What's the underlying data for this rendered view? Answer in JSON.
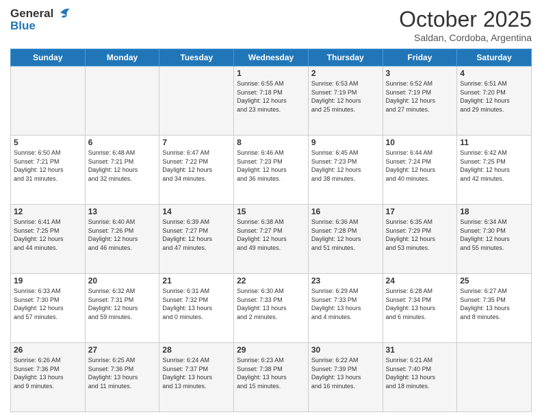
{
  "header": {
    "logo": {
      "line1": "General",
      "line2": "Blue"
    },
    "title": "October 2025",
    "subtitle": "Saldan, Cordoba, Argentina"
  },
  "weekdays": [
    "Sunday",
    "Monday",
    "Tuesday",
    "Wednesday",
    "Thursday",
    "Friday",
    "Saturday"
  ],
  "rows": [
    [
      {
        "day": "",
        "info": ""
      },
      {
        "day": "",
        "info": ""
      },
      {
        "day": "",
        "info": ""
      },
      {
        "day": "1",
        "info": "Sunrise: 6:55 AM\nSunset: 7:18 PM\nDaylight: 12 hours\nand 23 minutes."
      },
      {
        "day": "2",
        "info": "Sunrise: 6:53 AM\nSunset: 7:19 PM\nDaylight: 12 hours\nand 25 minutes."
      },
      {
        "day": "3",
        "info": "Sunrise: 6:52 AM\nSunset: 7:19 PM\nDaylight: 12 hours\nand 27 minutes."
      },
      {
        "day": "4",
        "info": "Sunrise: 6:51 AM\nSunset: 7:20 PM\nDaylight: 12 hours\nand 29 minutes."
      }
    ],
    [
      {
        "day": "5",
        "info": "Sunrise: 6:50 AM\nSunset: 7:21 PM\nDaylight: 12 hours\nand 31 minutes."
      },
      {
        "day": "6",
        "info": "Sunrise: 6:48 AM\nSunset: 7:21 PM\nDaylight: 12 hours\nand 32 minutes."
      },
      {
        "day": "7",
        "info": "Sunrise: 6:47 AM\nSunset: 7:22 PM\nDaylight: 12 hours\nand 34 minutes."
      },
      {
        "day": "8",
        "info": "Sunrise: 6:46 AM\nSunset: 7:23 PM\nDaylight: 12 hours\nand 36 minutes."
      },
      {
        "day": "9",
        "info": "Sunrise: 6:45 AM\nSunset: 7:23 PM\nDaylight: 12 hours\nand 38 minutes."
      },
      {
        "day": "10",
        "info": "Sunrise: 6:44 AM\nSunset: 7:24 PM\nDaylight: 12 hours\nand 40 minutes."
      },
      {
        "day": "11",
        "info": "Sunrise: 6:42 AM\nSunset: 7:25 PM\nDaylight: 12 hours\nand 42 minutes."
      }
    ],
    [
      {
        "day": "12",
        "info": "Sunrise: 6:41 AM\nSunset: 7:25 PM\nDaylight: 12 hours\nand 44 minutes."
      },
      {
        "day": "13",
        "info": "Sunrise: 6:40 AM\nSunset: 7:26 PM\nDaylight: 12 hours\nand 46 minutes."
      },
      {
        "day": "14",
        "info": "Sunrise: 6:39 AM\nSunset: 7:27 PM\nDaylight: 12 hours\nand 47 minutes."
      },
      {
        "day": "15",
        "info": "Sunrise: 6:38 AM\nSunset: 7:27 PM\nDaylight: 12 hours\nand 49 minutes."
      },
      {
        "day": "16",
        "info": "Sunrise: 6:36 AM\nSunset: 7:28 PM\nDaylight: 12 hours\nand 51 minutes."
      },
      {
        "day": "17",
        "info": "Sunrise: 6:35 AM\nSunset: 7:29 PM\nDaylight: 12 hours\nand 53 minutes."
      },
      {
        "day": "18",
        "info": "Sunrise: 6:34 AM\nSunset: 7:30 PM\nDaylight: 12 hours\nand 55 minutes."
      }
    ],
    [
      {
        "day": "19",
        "info": "Sunrise: 6:33 AM\nSunset: 7:30 PM\nDaylight: 12 hours\nand 57 minutes."
      },
      {
        "day": "20",
        "info": "Sunrise: 6:32 AM\nSunset: 7:31 PM\nDaylight: 12 hours\nand 59 minutes."
      },
      {
        "day": "21",
        "info": "Sunrise: 6:31 AM\nSunset: 7:32 PM\nDaylight: 13 hours\nand 0 minutes."
      },
      {
        "day": "22",
        "info": "Sunrise: 6:30 AM\nSunset: 7:33 PM\nDaylight: 13 hours\nand 2 minutes."
      },
      {
        "day": "23",
        "info": "Sunrise: 6:29 AM\nSunset: 7:33 PM\nDaylight: 13 hours\nand 4 minutes."
      },
      {
        "day": "24",
        "info": "Sunrise: 6:28 AM\nSunset: 7:34 PM\nDaylight: 13 hours\nand 6 minutes."
      },
      {
        "day": "25",
        "info": "Sunrise: 6:27 AM\nSunset: 7:35 PM\nDaylight: 13 hours\nand 8 minutes."
      }
    ],
    [
      {
        "day": "26",
        "info": "Sunrise: 6:26 AM\nSunset: 7:36 PM\nDaylight: 13 hours\nand 9 minutes."
      },
      {
        "day": "27",
        "info": "Sunrise: 6:25 AM\nSunset: 7:36 PM\nDaylight: 13 hours\nand 11 minutes."
      },
      {
        "day": "28",
        "info": "Sunrise: 6:24 AM\nSunset: 7:37 PM\nDaylight: 13 hours\nand 13 minutes."
      },
      {
        "day": "29",
        "info": "Sunrise: 6:23 AM\nSunset: 7:38 PM\nDaylight: 13 hours\nand 15 minutes."
      },
      {
        "day": "30",
        "info": "Sunrise: 6:22 AM\nSunset: 7:39 PM\nDaylight: 13 hours\nand 16 minutes."
      },
      {
        "day": "31",
        "info": "Sunrise: 6:21 AM\nSunset: 7:40 PM\nDaylight: 13 hours\nand 18 minutes."
      },
      {
        "day": "",
        "info": ""
      }
    ]
  ]
}
